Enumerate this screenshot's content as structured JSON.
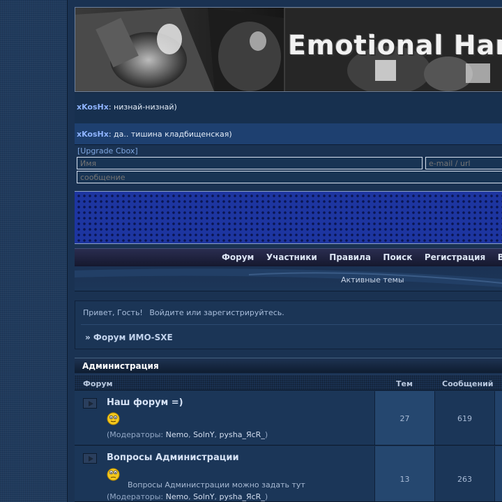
{
  "banner": {
    "title": "Emotional Har"
  },
  "cbox": {
    "messages": [
      {
        "nick": "xKosHx",
        "text": ": низнай-низнай)"
      },
      {
        "nick": "xKosHx",
        "text": ": да.. тишина кладбищенская)"
      }
    ],
    "upgrade_link": "[Upgrade Cbox]",
    "name_placeholder": "Имя",
    "email_placeholder": "e-mail / url",
    "message_placeholder": "сообщение"
  },
  "nav": {
    "items": [
      "Форум",
      "Участники",
      "Правила",
      "Поиск",
      "Регистрация",
      "В"
    ],
    "active_topics": "Активные темы"
  },
  "welcome": {
    "greeting": "Привет, Гость!",
    "login": "Войдите",
    "or": "или",
    "register": "зарегистрируйтесь.",
    "breadcrumb": "» Форум ИМО-SXE"
  },
  "section": {
    "title": "Администрация",
    "columns": {
      "forum": "Форум",
      "topics": "Тем",
      "posts": "Сообщений"
    }
  },
  "forums": [
    {
      "title": "Наш форум =)",
      "description": "",
      "moderators_label": "(Модераторы:",
      "moderators": [
        "Nemo",
        "SolnY",
        "pysha_ЯсR_"
      ],
      "topics": "27",
      "posts": "619"
    },
    {
      "title": "Вопросы Администрации",
      "description": "Вопросы Администрации можно задать тут",
      "moderators_label": "(Модераторы:",
      "moderators": [
        "Nemo",
        "SolnY",
        "pysha_ЯсR_"
      ],
      "topics": "13",
      "posts": "263"
    }
  ],
  "icons": {
    "forum_status": "forum-read-icon",
    "smiley": "smiley-icon"
  }
}
